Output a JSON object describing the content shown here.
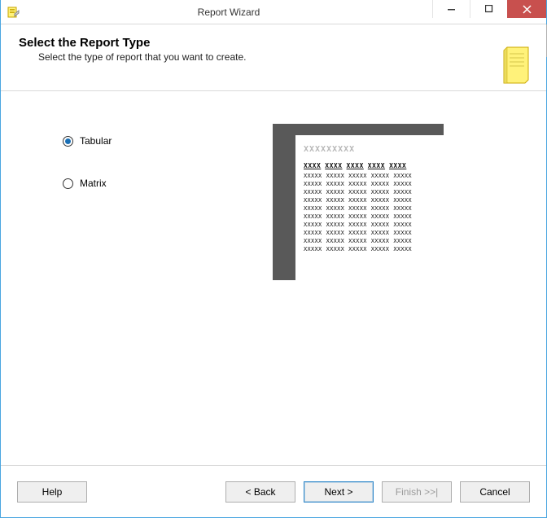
{
  "window": {
    "title": "Report Wizard"
  },
  "header": {
    "title": "Select the Report Type",
    "subtitle": "Select the type of report that you want to create."
  },
  "options": {
    "tabular": "Tabular",
    "matrix": "Matrix",
    "selected": "tabular"
  },
  "preview": {
    "title_glyph": "XXXXXXXXX",
    "col_glyph": "XXXX",
    "cell_glyph": "XXXXX",
    "columns": 5,
    "rows": 10
  },
  "buttons": {
    "help": "Help",
    "back": "< Back",
    "next": "Next >",
    "finish": "Finish >>|",
    "cancel": "Cancel"
  }
}
